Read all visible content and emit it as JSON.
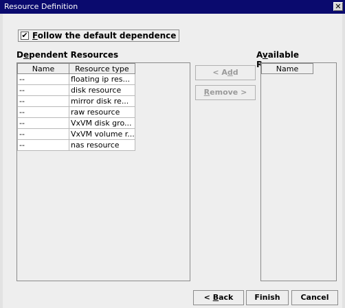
{
  "window": {
    "title": "Resource Definition",
    "close_glyph": "✕"
  },
  "follow_default": {
    "label": "Follow the default dependence",
    "checked": true,
    "check_glyph": "✔"
  },
  "dependent": {
    "header": "Dependent Resources",
    "columns": [
      "Name",
      "Resource type"
    ],
    "rows": [
      [
        "--",
        "floating ip res..."
      ],
      [
        "--",
        "disk resource"
      ],
      [
        "--",
        "mirror disk re..."
      ],
      [
        "--",
        "raw resource"
      ],
      [
        "--",
        "VxVM disk gro..."
      ],
      [
        "--",
        "VxVM volume r..."
      ],
      [
        "--",
        "nas resource"
      ]
    ]
  },
  "available": {
    "header": "Available Resources",
    "columns": [
      "Name"
    ]
  },
  "buttons": {
    "add": "< Add",
    "remove": "Remove >",
    "back": "< Back",
    "finish": "Finish",
    "cancel": "Cancel"
  }
}
